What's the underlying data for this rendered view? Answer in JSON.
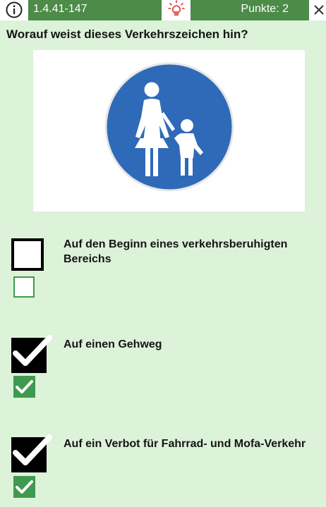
{
  "header": {
    "question_id": "1.4.41-147",
    "points": "Punkte: 2",
    "icons": {
      "info": "info-icon",
      "hint": "lightbulb-icon",
      "close": "close-icon"
    }
  },
  "question": {
    "text": "Worauf weist dieses Verkehrszeichen hin?",
    "image": "pedestrian-zone-sign"
  },
  "answers": [
    {
      "label": "Auf den Beginn eines verkehrsberuhigten Bereichs",
      "selected": false,
      "correct": false
    },
    {
      "label": "Auf einen Gehweg",
      "selected": true,
      "correct": true
    },
    {
      "label": "Auf ein Verbot für Fahrrad- und Mofa-Verkehr",
      "selected": true,
      "correct": true
    }
  ],
  "colors": {
    "header_green": "#4c8b48",
    "background": "#dcf2d9",
    "sign_blue": "#2f6ab9",
    "check_green": "#3f9a4f",
    "hint_red": "#d9342b"
  }
}
